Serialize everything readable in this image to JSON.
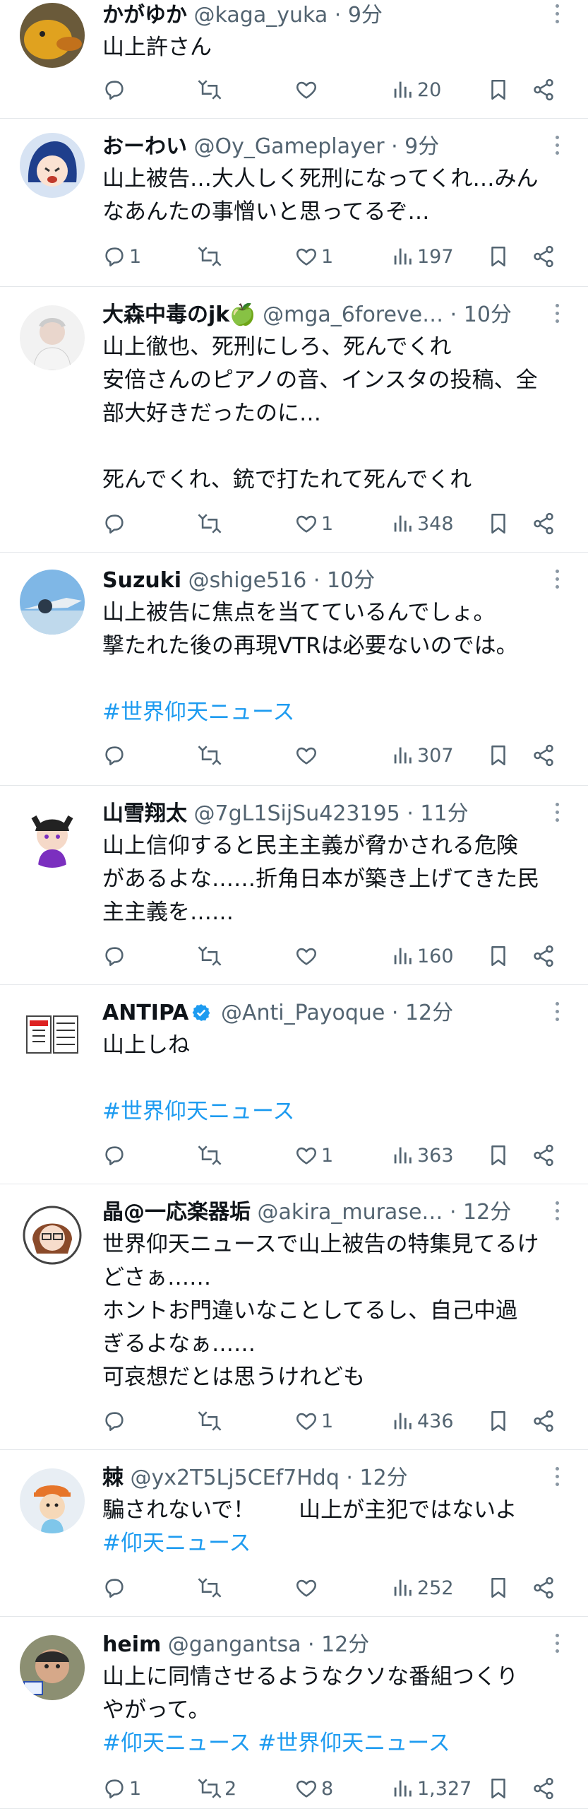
{
  "tweets": [
    {
      "name": "かがゆか",
      "handle": "@kaga_yuka",
      "time": "9分",
      "lines": [
        "山上許さん"
      ],
      "hashtags": [],
      "replies": "",
      "retweets": "",
      "likes": "",
      "views": "20"
    },
    {
      "name": "おーわい",
      "handle": "@Oy_Gameplayer",
      "time": "9分",
      "lines": [
        "山上被告…大人しく死刑になってくれ…みん",
        "なあんたの事憎いと思ってるぞ…"
      ],
      "hashtags": [],
      "replies": "1",
      "retweets": "",
      "likes": "1",
      "views": "197"
    },
    {
      "name": "大森中毒のjk🍏",
      "handle": "@mga_6foreve…",
      "time": "10分",
      "lines": [
        "山上徹也、死刑にしろ、死んでくれ",
        "安倍さんのピアノの音、インスタの投稿、全",
        "部大好きだったのに…",
        "",
        "死んでくれ、銃で打たれて死んでくれ"
      ],
      "hashtags": [],
      "replies": "",
      "retweets": "",
      "likes": "1",
      "views": "348"
    },
    {
      "name": "Suzuki",
      "handle": "@shige516",
      "time": "10分",
      "lines": [
        "山上被告に焦点を当てているんでしょ。",
        "撃たれた後の再現VTRは必要ないのでは。",
        ""
      ],
      "hashtags": [
        "#世界仰天ニュース"
      ],
      "replies": "",
      "retweets": "",
      "likes": "",
      "views": "307"
    },
    {
      "name": "山雪翔太",
      "handle": "@7gL1SijSu423195",
      "time": "11分",
      "lines": [
        "山上信仰すると民主主義が脅かされる危険",
        "があるよな……折角日本が築き上げてきた民",
        "主主義を……"
      ],
      "hashtags": [],
      "replies": "",
      "retweets": "",
      "likes": "",
      "views": "160"
    },
    {
      "name": "ANTIPA",
      "handle": "@Anti_Payoque",
      "time": "12分",
      "verified": true,
      "lines": [
        "山上しね",
        ""
      ],
      "hashtags": [
        "#世界仰天ニュース"
      ],
      "replies": "",
      "retweets": "",
      "likes": "1",
      "views": "363"
    },
    {
      "name": "晶@一応楽器垢",
      "handle": "@akira_murase…",
      "time": "12分",
      "lines": [
        "世界仰天ニュースで山上被告の特集見てるけ",
        "どさぁ……",
        "ホントお門違いなことしてるし、自己中過",
        "ぎるよなぁ……",
        "可哀想だとは思うけれども"
      ],
      "hashtags": [],
      "replies": "",
      "retweets": "",
      "likes": "1",
      "views": "436"
    },
    {
      "name": "棘",
      "handle": "@yx2T5Lj5CEf7Hdq",
      "time": "12分",
      "lines": [
        "騙されないで！　　山上が主犯ではないよ"
      ],
      "hashtags": [
        "#仰天ニュース"
      ],
      "replies": "",
      "retweets": "",
      "likes": "",
      "views": "252"
    },
    {
      "name": "heim",
      "handle": "@gangantsa",
      "time": "12分",
      "lines": [
        "山上に同情させるようなクソな番組つくり",
        "やがって。"
      ],
      "hashtags": [
        "#仰天ニュース #世界仰天ニュース"
      ],
      "replies": "1",
      "retweets": "2",
      "likes": "8",
      "views": "1,327"
    }
  ],
  "icons": {
    "reply": "reply-icon",
    "retweet": "retweet-icon",
    "like": "heart-icon",
    "views": "views-icon",
    "bookmark": "bookmark-icon",
    "share": "share-icon",
    "more": "more-dots-icon"
  },
  "colors": {
    "hashtag": "#1d9bf0",
    "muted": "#536471",
    "verified": "#1d9bf0",
    "text": "#0f1419"
  }
}
